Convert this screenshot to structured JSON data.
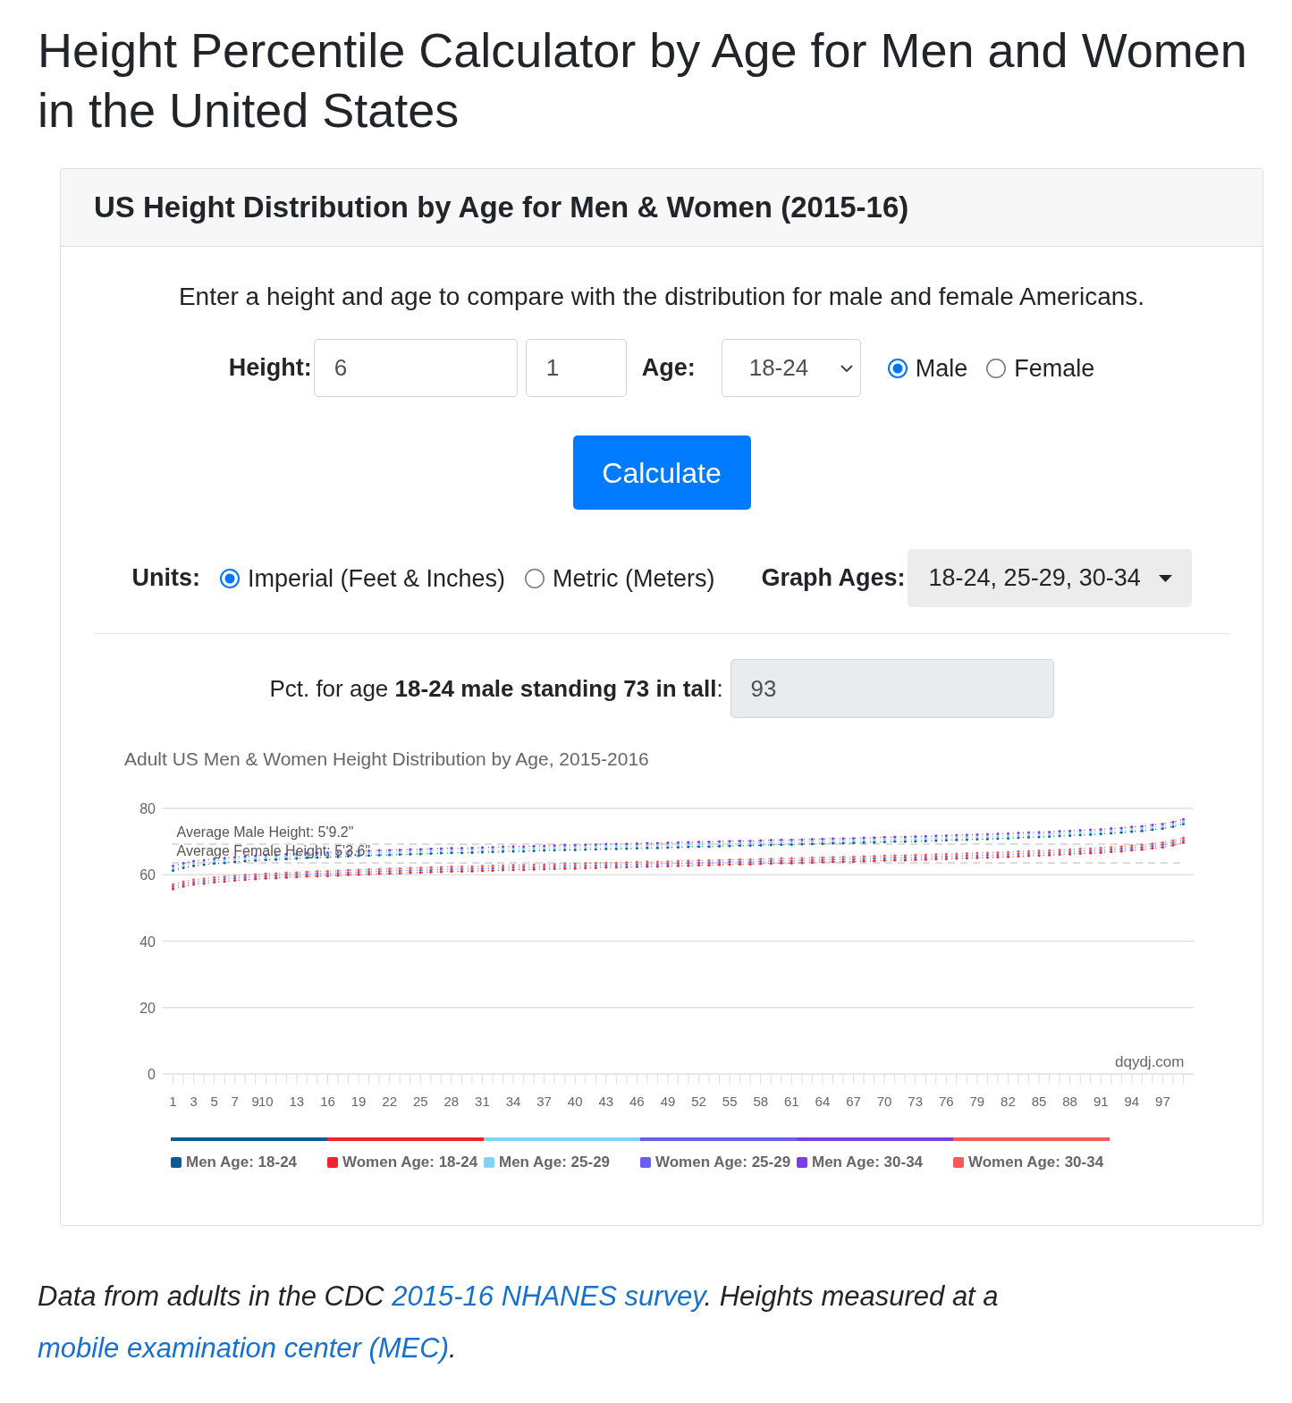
{
  "page_title": "Height Percentile Calculator by Age for Men and Women in the United States",
  "card": {
    "header": "US Height Distribution by Age for Men & Women (2015-16)",
    "intro": "Enter a height and age to compare with the distribution for male and female Americans.",
    "form": {
      "height_label": "Height:",
      "height_feet": "6",
      "height_inches": "1",
      "age_label": "Age:",
      "age_value": "18-24",
      "sex": [
        {
          "label": "Male",
          "selected": true
        },
        {
          "label": "Female",
          "selected": false
        }
      ]
    },
    "calculate_button": "Calculate",
    "units": {
      "label": "Units:",
      "options": [
        {
          "label": "Imperial (Feet & Inches)",
          "selected": true
        },
        {
          "label": "Metric (Meters)",
          "selected": false
        }
      ]
    },
    "graph_ages": {
      "label": "Graph Ages:",
      "value": "18-24, 25-29, 30-34"
    },
    "result": {
      "label": "Pct. for age **18-24 male standing 73 in tall**:",
      "value": "93"
    },
    "chart": {
      "credit": "dqydj.com",
      "chart_data": {
        "type": "line",
        "title": "Adult US Men & Women Height Distribution by Age, 2015-2016",
        "legend": "bottom",
        "grid": true,
        "xlim": [
          0,
          100
        ],
        "ylim": [
          0,
          80
        ],
        "yticks": [
          0,
          20,
          40,
          60,
          80
        ],
        "xticks": [
          1,
          3,
          5,
          7,
          9,
          10,
          13,
          16,
          19,
          22,
          25,
          28,
          31,
          34,
          37,
          40,
          43,
          46,
          49,
          52,
          55,
          58,
          61,
          64,
          67,
          70,
          73,
          76,
          79,
          82,
          85,
          88,
          91,
          94,
          97
        ],
        "x": [
          1,
          2,
          3,
          4,
          5,
          6,
          7,
          8,
          9,
          10,
          11,
          12,
          13,
          14,
          15,
          16,
          17,
          18,
          19,
          20,
          21,
          22,
          23,
          24,
          25,
          26,
          27,
          28,
          29,
          30,
          31,
          32,
          33,
          34,
          35,
          36,
          37,
          38,
          39,
          40,
          41,
          42,
          43,
          44,
          45,
          46,
          47,
          48,
          49,
          50,
          51,
          52,
          53,
          54,
          55,
          56,
          57,
          58,
          59,
          60,
          61,
          62,
          63,
          64,
          65,
          66,
          67,
          68,
          69,
          70,
          71,
          72,
          73,
          74,
          75,
          76,
          77,
          78,
          79,
          80,
          81,
          82,
          83,
          84,
          85,
          86,
          87,
          88,
          89,
          90,
          91,
          92,
          93,
          94,
          95,
          96,
          97,
          98,
          99
        ],
        "series": [
          {
            "name": "Men Age: 18-24",
            "color": "#0a5d8c",
            "line_style": "dotted",
            "values": [
              61.3,
              62.1,
              62.7,
              63.0,
              63.4,
              63.6,
              63.9,
              64.1,
              64.3,
              64.5,
              64.6,
              64.8,
              64.9,
              65.1,
              65.2,
              65.3,
              65.4,
              65.6,
              65.7,
              65.8,
              65.9,
              66.0,
              66.1,
              66.2,
              66.3,
              66.4,
              66.5,
              66.6,
              66.6,
              66.7,
              66.8,
              66.9,
              67.0,
              67.1,
              67.1,
              67.2,
              67.3,
              67.4,
              67.5,
              67.5,
              67.6,
              67.7,
              67.8,
              67.8,
              67.9,
              68.0,
              68.1,
              68.1,
              68.2,
              68.3,
              68.4,
              68.5,
              68.5,
              68.6,
              68.7,
              68.8,
              68.8,
              68.9,
              69.0,
              69.1,
              69.1,
              69.2,
              69.3,
              69.4,
              69.5,
              69.5,
              69.6,
              69.7,
              69.8,
              69.9,
              70.0,
              70.0,
              70.1,
              70.2,
              70.3,
              70.4,
              70.5,
              70.6,
              70.7,
              70.8,
              70.9,
              71.0,
              71.2,
              71.3,
              71.4,
              71.5,
              71.7,
              71.8,
              72.0,
              72.1,
              72.3,
              72.5,
              72.7,
              73.0,
              73.2,
              73.6,
              73.9,
              74.5,
              75.3
            ]
          },
          {
            "name": "Women Age: 18-24",
            "color": "#f5202f",
            "line_style": "dotted",
            "values": [
              55.7,
              56.5,
              57.1,
              57.4,
              57.8,
              58.0,
              58.3,
              58.5,
              58.7,
              58.9,
              59.0,
              59.2,
              59.3,
              59.5,
              59.6,
              59.7,
              59.8,
              60.0,
              60.1,
              60.2,
              60.3,
              60.4,
              60.5,
              60.6,
              60.7,
              60.8,
              60.9,
              61.0,
              61.0,
              61.1,
              61.2,
              61.3,
              61.4,
              61.5,
              61.5,
              61.6,
              61.7,
              61.8,
              61.9,
              61.9,
              62.0,
              62.1,
              62.2,
              62.2,
              62.3,
              62.4,
              62.5,
              62.5,
              62.6,
              62.7,
              62.8,
              62.9,
              62.9,
              63.0,
              63.1,
              63.2,
              63.2,
              63.3,
              63.4,
              63.5,
              63.5,
              63.6,
              63.7,
              63.8,
              63.9,
              63.9,
              64.0,
              64.1,
              64.2,
              64.3,
              64.4,
              64.4,
              64.5,
              64.6,
              64.7,
              64.8,
              64.9,
              65.0,
              65.1,
              65.2,
              65.3,
              65.4,
              65.6,
              65.7,
              65.8,
              65.9,
              66.1,
              66.2,
              66.4,
              66.5,
              66.7,
              66.9,
              67.1,
              67.4,
              67.6,
              68.0,
              68.3,
              68.9,
              69.7
            ]
          },
          {
            "name": "Men Age: 25-29",
            "color": "#7fd3f7",
            "line_style": "dotted",
            "values": [
              62.0,
              62.8,
              63.4,
              63.7,
              64.1,
              64.3,
              64.6,
              64.8,
              65.0,
              65.2,
              65.3,
              65.5,
              65.6,
              65.8,
              65.9,
              66.0,
              66.1,
              66.3,
              66.4,
              66.5,
              66.6,
              66.7,
              66.8,
              66.9,
              67.0,
              67.1,
              67.2,
              67.3,
              67.3,
              67.4,
              67.5,
              67.6,
              67.7,
              67.8,
              67.8,
              67.9,
              68.0,
              68.1,
              68.2,
              68.2,
              68.3,
              68.4,
              68.5,
              68.5,
              68.6,
              68.7,
              68.8,
              68.8,
              68.9,
              69.0,
              69.1,
              69.2,
              69.2,
              69.3,
              69.4,
              69.5,
              69.5,
              69.6,
              69.7,
              69.8,
              69.8,
              69.9,
              70.0,
              70.1,
              70.2,
              70.2,
              70.3,
              70.4,
              70.5,
              70.6,
              70.7,
              70.7,
              70.8,
              70.9,
              71.0,
              71.1,
              71.2,
              71.3,
              71.4,
              71.5,
              71.6,
              71.7,
              71.9,
              72.0,
              72.1,
              72.2,
              72.4,
              72.5,
              72.7,
              72.8,
              73.0,
              73.2,
              73.4,
              73.7,
              73.9,
              74.3,
              74.6,
              75.2,
              76.0
            ]
          },
          {
            "name": "Women Age: 25-29",
            "color": "#6a5ef0",
            "line_style": "dotted",
            "values": [
              56.4,
              57.2,
              57.8,
              58.1,
              58.5,
              58.7,
              59.0,
              59.2,
              59.4,
              59.6,
              59.7,
              59.9,
              60.0,
              60.2,
              60.3,
              60.4,
              60.5,
              60.7,
              60.8,
              60.9,
              61.0,
              61.1,
              61.2,
              61.3,
              61.4,
              61.5,
              61.6,
              61.7,
              61.7,
              61.8,
              61.9,
              62.0,
              62.1,
              62.2,
              62.2,
              62.3,
              62.4,
              62.5,
              62.6,
              62.6,
              62.7,
              62.8,
              62.9,
              62.9,
              63.0,
              63.1,
              63.2,
              63.2,
              63.3,
              63.4,
              63.5,
              63.6,
              63.6,
              63.7,
              63.8,
              63.9,
              63.9,
              64.0,
              64.1,
              64.2,
              64.2,
              64.3,
              64.4,
              64.5,
              64.6,
              64.6,
              64.7,
              64.8,
              64.9,
              65.0,
              65.1,
              65.1,
              65.2,
              65.3,
              65.4,
              65.5,
              65.6,
              65.7,
              65.8,
              65.9,
              66.0,
              66.1,
              66.3,
              66.4,
              66.5,
              66.6,
              66.8,
              66.9,
              67.1,
              67.2,
              67.4,
              67.6,
              67.8,
              68.1,
              68.3,
              68.7,
              69.0,
              69.6,
              70.4
            ]
          },
          {
            "name": "Men Age: 30-34",
            "color": "#7a3fe0",
            "line_style": "dotted",
            "values": [
              62.7,
              63.5,
              64.1,
              64.4,
              64.8,
              65.0,
              65.3,
              65.5,
              65.7,
              65.9,
              66.0,
              66.2,
              66.3,
              66.5,
              66.6,
              66.7,
              66.8,
              67.0,
              67.1,
              67.2,
              67.3,
              67.4,
              67.5,
              67.6,
              67.7,
              67.8,
              67.9,
              68.0,
              68.0,
              68.1,
              68.2,
              68.3,
              68.4,
              68.5,
              68.5,
              68.6,
              68.7,
              68.8,
              68.9,
              68.9,
              69.0,
              69.1,
              69.2,
              69.2,
              69.3,
              69.4,
              69.5,
              69.5,
              69.6,
              69.7,
              69.8,
              69.9,
              69.9,
              70.0,
              70.1,
              70.2,
              70.2,
              70.3,
              70.4,
              70.5,
              70.5,
              70.6,
              70.7,
              70.8,
              70.9,
              70.9,
              71.0,
              71.1,
              71.2,
              71.3,
              71.4,
              71.4,
              71.5,
              71.6,
              71.7,
              71.8,
              71.9,
              72.0,
              72.1,
              72.2,
              72.3,
              72.4,
              72.6,
              72.7,
              72.8,
              72.9,
              73.1,
              73.2,
              73.4,
              73.5,
              73.7,
              73.9,
              74.1,
              74.4,
              74.6,
              75.0,
              75.3,
              75.9,
              76.7
            ]
          },
          {
            "name": "Women Age: 30-34",
            "color": "#f55a5a",
            "line_style": "dotted",
            "values": [
              57.1,
              57.9,
              58.5,
              58.8,
              59.2,
              59.4,
              59.7,
              59.9,
              60.1,
              60.3,
              60.4,
              60.6,
              60.7,
              60.9,
              61.0,
              61.1,
              61.2,
              61.4,
              61.5,
              61.6,
              61.7,
              61.8,
              61.9,
              62.0,
              62.1,
              62.2,
              62.3,
              62.4,
              62.4,
              62.5,
              62.6,
              62.7,
              62.8,
              62.9,
              62.9,
              63.0,
              63.1,
              63.2,
              63.3,
              63.3,
              63.4,
              63.5,
              63.6,
              63.6,
              63.7,
              63.8,
              63.9,
              63.9,
              64.0,
              64.1,
              64.2,
              64.3,
              64.3,
              64.4,
              64.5,
              64.6,
              64.6,
              64.7,
              64.8,
              64.9,
              64.9,
              65.0,
              65.1,
              65.2,
              65.3,
              65.3,
              65.4,
              65.5,
              65.6,
              65.7,
              65.8,
              65.8,
              65.9,
              66.0,
              66.1,
              66.2,
              66.3,
              66.4,
              66.5,
              66.6,
              66.7,
              66.8,
              67.0,
              67.1,
              67.2,
              67.3,
              67.5,
              67.6,
              67.8,
              67.9,
              68.1,
              68.3,
              68.5,
              68.8,
              69.0,
              69.4,
              69.7,
              70.3,
              71.1
            ]
          }
        ],
        "ref_lines": [
          {
            "axis": "y",
            "value": 69.2
          },
          {
            "axis": "y",
            "value": 63.6
          }
        ],
        "annotations": [
          "Average Male Height: 5'9.2\"",
          "Average Female Height: 5'3.6\""
        ]
      }
    }
  },
  "footnote": [
    {
      "kind": "text",
      "text": "Data from adults in the CDC "
    },
    {
      "kind": "link",
      "text": "2015-16 NHANES survey"
    },
    {
      "kind": "text",
      "text": ". Heights measured at a "
    },
    {
      "kind": "link",
      "text": "mobile examination center (MEC)"
    },
    {
      "kind": "text",
      "text": "."
    }
  ]
}
